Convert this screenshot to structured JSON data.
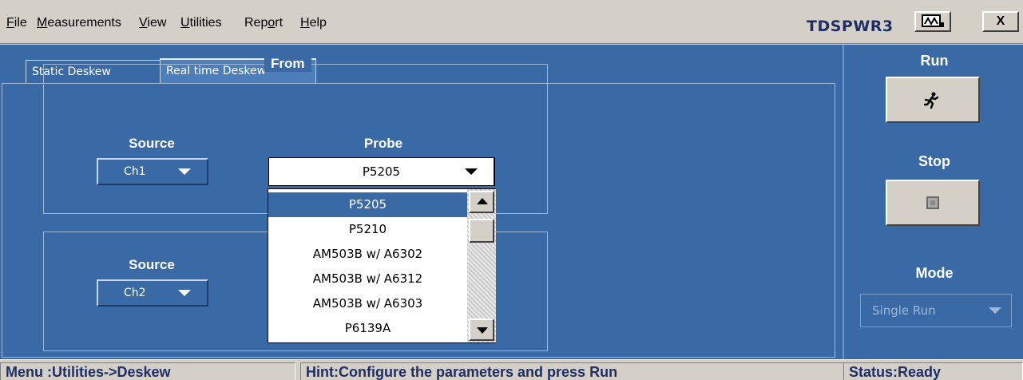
{
  "menu": {
    "items": [
      {
        "label": "File",
        "u": "F",
        "rest": "ile"
      },
      {
        "label": "Measurements",
        "u": "M",
        "rest": "easurements"
      },
      {
        "label": "View",
        "u": "V",
        "rest": "iew"
      },
      {
        "label": "Utilities",
        "u": "U",
        "rest": "tilities"
      },
      {
        "label": "Report",
        "pre": "Rep",
        "u": "o",
        "rest": "rt"
      },
      {
        "label": "Help",
        "u": "H",
        "rest": "elp"
      }
    ],
    "app_title": "TDSPWR3",
    "minimize_label": "",
    "close_label": "X"
  },
  "tabs": [
    "Static Deskew",
    "Real time Deskew"
  ],
  "from_group": {
    "title": "From",
    "source_label": "Source",
    "source_value": "Ch1",
    "probe_label": "Probe",
    "probe_value": "P5205"
  },
  "to_group": {
    "source_label": "Source",
    "source_value": "Ch2"
  },
  "probe_options": [
    "P5205",
    "P5210",
    "AM503B w/ A6302",
    "AM503B w/ A6312",
    "AM503B w/ A6303",
    "P6139A"
  ],
  "side": {
    "run_label": "Run",
    "stop_label": "Stop",
    "mode_label": "Mode",
    "mode_value": "Single Run"
  },
  "status": {
    "menu_path": "Menu :Utilities->Deskew",
    "hint": "Hint:Configure the parameters and press Run",
    "state": "Status:Ready"
  },
  "colors": {
    "panel": "#3a6aa5",
    "selection": "#3a6aa5",
    "status_text": "#1f2e64"
  }
}
